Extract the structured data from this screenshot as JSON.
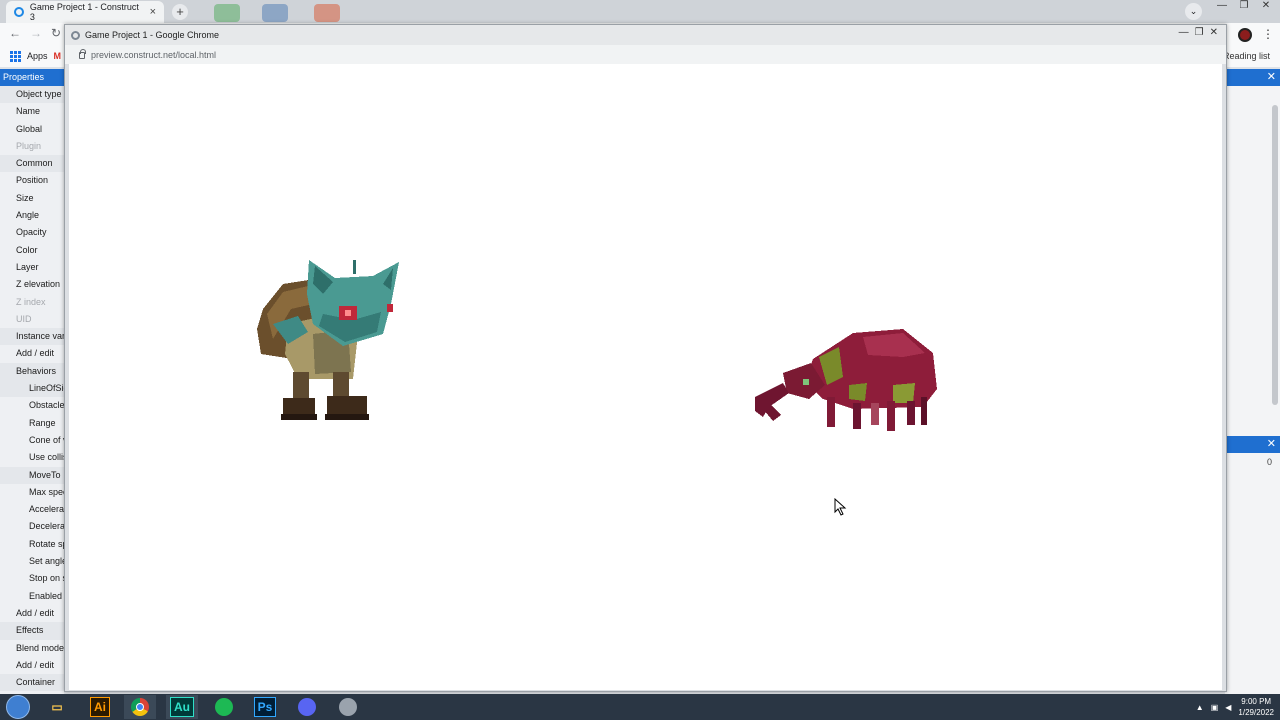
{
  "background_browser": {
    "tab_title": "Game Project 1 - Construct 3",
    "new_tab_label": "+",
    "bookmarks": {
      "apps_label": "Apps",
      "gmail_initial": "M"
    },
    "reading_list_label": "Reading list"
  },
  "properties_panel": {
    "title": "Properties",
    "rows": [
      {
        "label": "Object type",
        "kind": "section"
      },
      {
        "label": "Name",
        "kind": "item"
      },
      {
        "label": "Global",
        "kind": "item"
      },
      {
        "label": "Plugin",
        "kind": "dim"
      },
      {
        "label": "Common",
        "kind": "section"
      },
      {
        "label": "Position",
        "kind": "item"
      },
      {
        "label": "Size",
        "kind": "item"
      },
      {
        "label": "Angle",
        "kind": "item"
      },
      {
        "label": "Opacity",
        "kind": "item"
      },
      {
        "label": "Color",
        "kind": "item"
      },
      {
        "label": "Layer",
        "kind": "item"
      },
      {
        "label": "Z elevation",
        "kind": "item"
      },
      {
        "label": "Z index",
        "kind": "dim"
      },
      {
        "label": "UID",
        "kind": "dim"
      },
      {
        "label": "Instance variables",
        "kind": "section"
      },
      {
        "label": "Add / edit",
        "kind": "item"
      },
      {
        "label": "Behaviors",
        "kind": "section"
      },
      {
        "label": "LineOfSight",
        "kind": "sub-section"
      },
      {
        "label": "Obstacles",
        "kind": "sub"
      },
      {
        "label": "Range",
        "kind": "sub"
      },
      {
        "label": "Cone of view",
        "kind": "sub"
      },
      {
        "label": "Use collision cells",
        "kind": "sub"
      },
      {
        "label": "MoveTo",
        "kind": "sub-section"
      },
      {
        "label": "Max speed",
        "kind": "sub"
      },
      {
        "label": "Acceleration",
        "kind": "sub"
      },
      {
        "label": "Deceleration",
        "kind": "sub"
      },
      {
        "label": "Rotate speed",
        "kind": "sub"
      },
      {
        "label": "Set angle",
        "kind": "sub"
      },
      {
        "label": "Stop on solids",
        "kind": "sub"
      },
      {
        "label": "Enabled",
        "kind": "sub"
      },
      {
        "label": "Add / edit",
        "kind": "item"
      },
      {
        "label": "Effects",
        "kind": "section"
      },
      {
        "label": "Blend mode",
        "kind": "item"
      },
      {
        "label": "Add / edit",
        "kind": "item"
      },
      {
        "label": "Container",
        "kind": "section"
      }
    ]
  },
  "right_panel": {
    "close_glyph": "✕",
    "value": "0"
  },
  "preview_window": {
    "title": "Game Project 1 - Google Chrome",
    "url": "preview.construct.net/local.html",
    "controls": [
      "—",
      "❐",
      "✕"
    ]
  },
  "game_sprites": [
    {
      "name": "goblin-sprite"
    },
    {
      "name": "beetle-sprite"
    }
  ],
  "taskbar": {
    "apps": [
      {
        "name": "file-explorer",
        "label": "▭"
      },
      {
        "name": "illustrator",
        "label": "Ai"
      },
      {
        "name": "chrome",
        "label": ""
      },
      {
        "name": "audition",
        "label": "Au"
      },
      {
        "name": "spotify",
        "label": ""
      },
      {
        "name": "photoshop",
        "label": "Ps"
      },
      {
        "name": "discord",
        "label": ""
      },
      {
        "name": "generic-app",
        "label": ""
      }
    ],
    "clock_time": "9:00 PM",
    "clock_date": "1/29/2022"
  },
  "colors": {
    "accent_blue": "#1f6fd0",
    "goblin_skin": "#4a9a92",
    "beetle_body": "#8e1d3a",
    "taskbar": "#2a3644"
  }
}
